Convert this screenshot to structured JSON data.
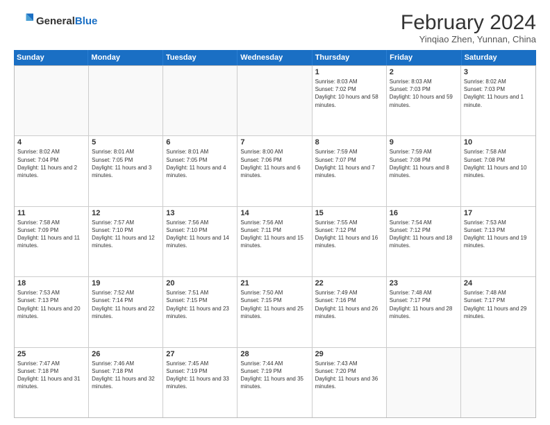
{
  "header": {
    "logo_line1": "General",
    "logo_line2": "Blue",
    "title": "February 2024",
    "location": "Yinqiao Zhen, Yunnan, China"
  },
  "days_of_week": [
    "Sunday",
    "Monday",
    "Tuesday",
    "Wednesday",
    "Thursday",
    "Friday",
    "Saturday"
  ],
  "weeks": [
    [
      {
        "day": "",
        "text": ""
      },
      {
        "day": "",
        "text": ""
      },
      {
        "day": "",
        "text": ""
      },
      {
        "day": "",
        "text": ""
      },
      {
        "day": "1",
        "text": "Sunrise: 8:03 AM\nSunset: 7:02 PM\nDaylight: 10 hours and 58 minutes."
      },
      {
        "day": "2",
        "text": "Sunrise: 8:03 AM\nSunset: 7:03 PM\nDaylight: 10 hours and 59 minutes."
      },
      {
        "day": "3",
        "text": "Sunrise: 8:02 AM\nSunset: 7:03 PM\nDaylight: 11 hours and 1 minute."
      }
    ],
    [
      {
        "day": "4",
        "text": "Sunrise: 8:02 AM\nSunset: 7:04 PM\nDaylight: 11 hours and 2 minutes."
      },
      {
        "day": "5",
        "text": "Sunrise: 8:01 AM\nSunset: 7:05 PM\nDaylight: 11 hours and 3 minutes."
      },
      {
        "day": "6",
        "text": "Sunrise: 8:01 AM\nSunset: 7:05 PM\nDaylight: 11 hours and 4 minutes."
      },
      {
        "day": "7",
        "text": "Sunrise: 8:00 AM\nSunset: 7:06 PM\nDaylight: 11 hours and 6 minutes."
      },
      {
        "day": "8",
        "text": "Sunrise: 7:59 AM\nSunset: 7:07 PM\nDaylight: 11 hours and 7 minutes."
      },
      {
        "day": "9",
        "text": "Sunrise: 7:59 AM\nSunset: 7:08 PM\nDaylight: 11 hours and 8 minutes."
      },
      {
        "day": "10",
        "text": "Sunrise: 7:58 AM\nSunset: 7:08 PM\nDaylight: 11 hours and 10 minutes."
      }
    ],
    [
      {
        "day": "11",
        "text": "Sunrise: 7:58 AM\nSunset: 7:09 PM\nDaylight: 11 hours and 11 minutes."
      },
      {
        "day": "12",
        "text": "Sunrise: 7:57 AM\nSunset: 7:10 PM\nDaylight: 11 hours and 12 minutes."
      },
      {
        "day": "13",
        "text": "Sunrise: 7:56 AM\nSunset: 7:10 PM\nDaylight: 11 hours and 14 minutes."
      },
      {
        "day": "14",
        "text": "Sunrise: 7:56 AM\nSunset: 7:11 PM\nDaylight: 11 hours and 15 minutes."
      },
      {
        "day": "15",
        "text": "Sunrise: 7:55 AM\nSunset: 7:12 PM\nDaylight: 11 hours and 16 minutes."
      },
      {
        "day": "16",
        "text": "Sunrise: 7:54 AM\nSunset: 7:12 PM\nDaylight: 11 hours and 18 minutes."
      },
      {
        "day": "17",
        "text": "Sunrise: 7:53 AM\nSunset: 7:13 PM\nDaylight: 11 hours and 19 minutes."
      }
    ],
    [
      {
        "day": "18",
        "text": "Sunrise: 7:53 AM\nSunset: 7:13 PM\nDaylight: 11 hours and 20 minutes."
      },
      {
        "day": "19",
        "text": "Sunrise: 7:52 AM\nSunset: 7:14 PM\nDaylight: 11 hours and 22 minutes."
      },
      {
        "day": "20",
        "text": "Sunrise: 7:51 AM\nSunset: 7:15 PM\nDaylight: 11 hours and 23 minutes."
      },
      {
        "day": "21",
        "text": "Sunrise: 7:50 AM\nSunset: 7:15 PM\nDaylight: 11 hours and 25 minutes."
      },
      {
        "day": "22",
        "text": "Sunrise: 7:49 AM\nSunset: 7:16 PM\nDaylight: 11 hours and 26 minutes."
      },
      {
        "day": "23",
        "text": "Sunrise: 7:48 AM\nSunset: 7:17 PM\nDaylight: 11 hours and 28 minutes."
      },
      {
        "day": "24",
        "text": "Sunrise: 7:48 AM\nSunset: 7:17 PM\nDaylight: 11 hours and 29 minutes."
      }
    ],
    [
      {
        "day": "25",
        "text": "Sunrise: 7:47 AM\nSunset: 7:18 PM\nDaylight: 11 hours and 31 minutes."
      },
      {
        "day": "26",
        "text": "Sunrise: 7:46 AM\nSunset: 7:18 PM\nDaylight: 11 hours and 32 minutes."
      },
      {
        "day": "27",
        "text": "Sunrise: 7:45 AM\nSunset: 7:19 PM\nDaylight: 11 hours and 33 minutes."
      },
      {
        "day": "28",
        "text": "Sunrise: 7:44 AM\nSunset: 7:19 PM\nDaylight: 11 hours and 35 minutes."
      },
      {
        "day": "29",
        "text": "Sunrise: 7:43 AM\nSunset: 7:20 PM\nDaylight: 11 hours and 36 minutes."
      },
      {
        "day": "",
        "text": ""
      },
      {
        "day": "",
        "text": ""
      }
    ]
  ]
}
